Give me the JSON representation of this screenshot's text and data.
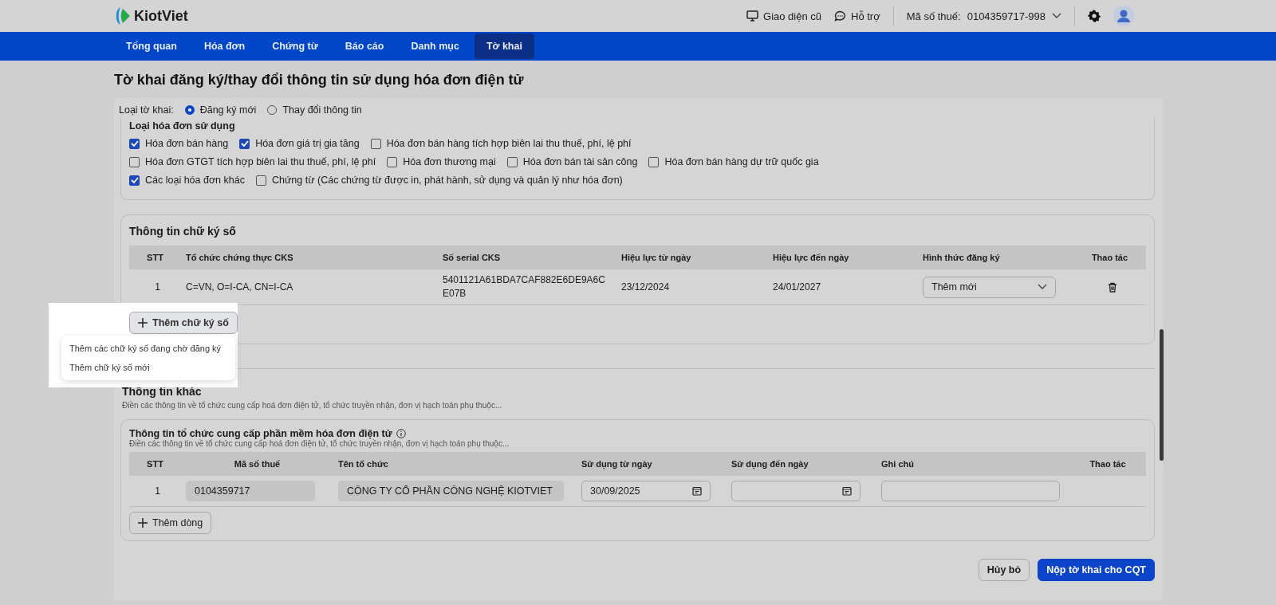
{
  "header": {
    "logo": "KiotViet",
    "links": [
      {
        "kind": "monitor",
        "label": "Giao diện cũ"
      },
      {
        "kind": "chat",
        "label": "Hỗ trợ"
      }
    ],
    "tax_label": "Mã số thuế:",
    "tax_value": "0104359717-998"
  },
  "nav": [
    {
      "label": "Tổng quan",
      "selected": false
    },
    {
      "label": "Hóa đơn",
      "selected": false
    },
    {
      "label": "Chứng từ",
      "selected": false
    },
    {
      "label": "Báo cáo",
      "selected": false
    },
    {
      "label": "Danh mục",
      "selected": false
    },
    {
      "label": "Tờ khai",
      "selected": true
    }
  ],
  "page_title": "Tờ khai đăng ký/thay đổi thông tin sử dụng hóa đơn điện tử",
  "declaration_type": {
    "label": "Loại tờ khai:",
    "options": [
      {
        "label": "Đăng ký mới",
        "selected": true
      },
      {
        "label": "Thay đổi thông tin",
        "selected": false
      }
    ]
  },
  "invoice_types": {
    "title": "Loại hóa đơn sử dụng",
    "rows": [
      [
        {
          "label": "Hóa đơn bán hàng",
          "checked": true
        },
        {
          "label": "Hóa đơn giá trị gia tăng",
          "checked": true
        },
        {
          "label": "Hóa đơn bán hàng tích hợp biên lai thu thuế, phí, lệ phí",
          "checked": false
        }
      ],
      [
        {
          "label": "Hóa đơn GTGT tích hợp biên lai thu thuế, phí, lệ phí",
          "checked": false
        },
        {
          "label": "Hóa đơn thương mại",
          "checked": false
        },
        {
          "label": "Hóa đơn bán tài sản công",
          "checked": false
        },
        {
          "label": "Hóa đơn bán hàng dự trữ quốc gia",
          "checked": false
        }
      ],
      [
        {
          "label": "Các loại hóa đơn khác",
          "checked": true
        },
        {
          "label": "Chứng từ (Các chứng từ được in, phát hành, sử dụng và quản lý như hóa đơn)",
          "checked": false
        }
      ]
    ]
  },
  "signatures": {
    "title": "Thông tin chữ ký số",
    "columns": [
      "STT",
      "Tổ chức chứng thực CKS",
      "Số serial CKS",
      "Hiệu lực từ ngày",
      "Hiệu lực đến ngày",
      "Hình thức đăng ký",
      "Thao tác"
    ],
    "rows": [
      {
        "index": "1",
        "issuer": "C=VN, O=I-CA, CN=I-CA",
        "serial": "5401121A61BDA7CAF882E6DE9A6C E07B",
        "from": "23/12/2024",
        "to": "24/01/2027",
        "mode": "Thêm mới"
      }
    ],
    "add_button": "Thêm chữ ký số",
    "menu": [
      "Thêm các chữ ký số đang chờ đăng ký",
      "Thêm chữ ký số mới"
    ]
  },
  "other": {
    "title": "Thông tin khác",
    "subtitle": "Điền các thông tin về tổ chức cung cấp hoá đơn điện tử, tổ chức truyền nhận, đơn vị hạch toán phụ thuộc..."
  },
  "providers": {
    "title": "Thông tin tổ chức cung cấp phần mềm hóa đơn điện tử",
    "subtitle": "Điền các thông tin về tổ chức cung cấp hoá đơn điện tử, tổ chức truyền nhận, đơn vị hạch toán phụ thuộc...",
    "columns": [
      "STT",
      "Mã số thuế",
      "Tên tổ chức",
      "Sử dụng từ ngày",
      "Sử dụng đến ngày",
      "Ghi chú",
      "Thao tác"
    ],
    "rows": [
      {
        "index": "1",
        "tax_code": "0104359717",
        "name": "CÔNG TY CỔ PHẦN CÔNG NGHỆ KIOTVIET",
        "from": "30/09/2025"
      }
    ],
    "add_button": "Thêm dòng"
  },
  "buttons": {
    "cancel": "Hủy bỏ",
    "submit": "Nộp tờ khai cho CQT"
  }
}
